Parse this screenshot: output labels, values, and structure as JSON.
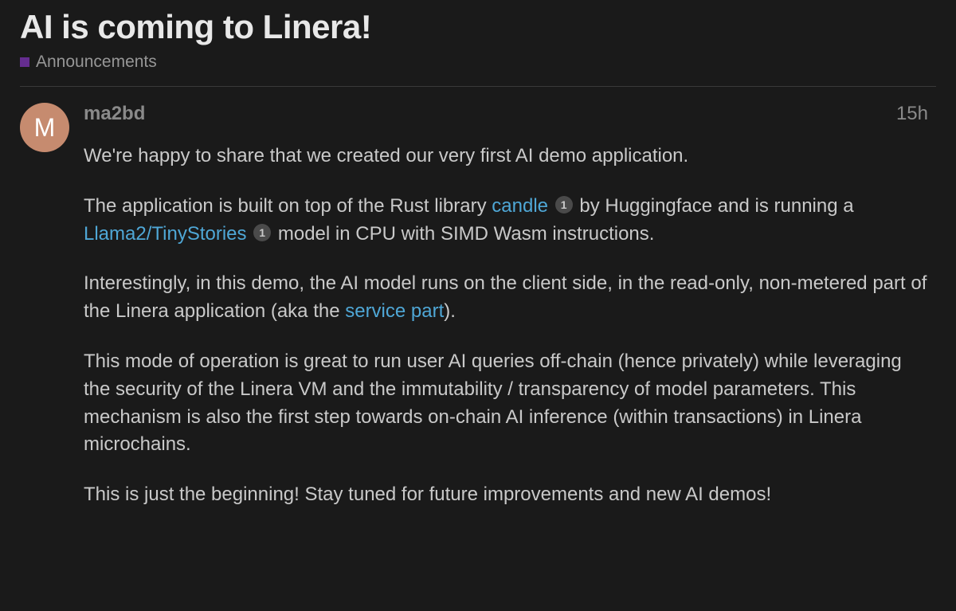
{
  "topic": {
    "title": "AI is coming to Linera!",
    "category": "Announcements",
    "categoryColor": "#652d90"
  },
  "post": {
    "author": "ma2bd",
    "authorInitial": "M",
    "avatarColor": "#c68b6f",
    "timestamp": "15h",
    "paragraphs": {
      "p1": "We're happy to share that we created our very first AI demo application.",
      "p2_part1": "The application is built on top of the Rust library ",
      "p2_link1": "candle",
      "p2_badge1": "1",
      "p2_part2": " by Huggingface and is running a ",
      "p2_link2": "Llama2/TinyStories",
      "p2_badge2": "1",
      "p2_part3": " model in CPU with SIMD Wasm instructions.",
      "p3_part1": "Interestingly, in this demo, the AI model runs on the client side, in the read-only, non-metered part of the Linera application (aka the ",
      "p3_link1": "service part",
      "p3_part2": ").",
      "p4": "This mode of operation is great to run user AI queries off-chain (hence privately) while leveraging the security of the Linera VM and the immutability / transparency of model parameters. This mechanism is also the first step towards on-chain AI inference (within transactions) in Linera microchains.",
      "p5": "This is just the beginning! Stay tuned for future improvements and new AI demos!"
    }
  }
}
